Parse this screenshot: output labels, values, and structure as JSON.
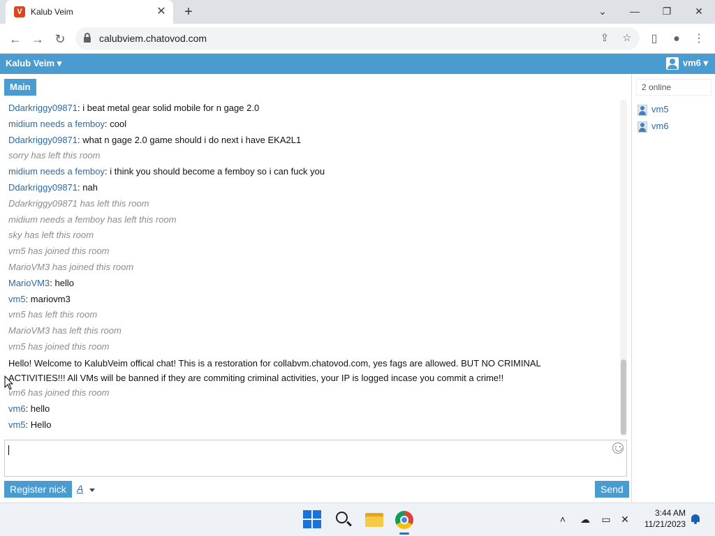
{
  "browser": {
    "tab_title": "Kalub Veim",
    "tab_favicon_letter": "V",
    "url": "calubviem.chatovod.com",
    "new_tab_glyph": "+",
    "close_glyph": "✕"
  },
  "chat": {
    "room_menu_label": "Kalub Veim ▾",
    "user_menu_label": "vm6 ▾",
    "main_tab": "Main",
    "messages": [
      {
        "nick": "Ddarkriggy09871",
        "text": "i beat metal gear solid mobile for n gage 2.0"
      },
      {
        "nick": "midium needs a femboy",
        "text": "cool"
      },
      {
        "nick": "Ddarkriggy09871",
        "text": "what n gage 2.0 game should i do next i have EKA2L1"
      },
      {
        "system": "sorry has left this room"
      },
      {
        "nick": "midium needs a femboy",
        "text": "i think you should become a femboy so i can fuck you"
      },
      {
        "nick": "Ddarkriggy09871",
        "text": "nah"
      },
      {
        "system": "Ddarkriggy09871 has left this room"
      },
      {
        "system": "midium needs a femboy has left this room"
      },
      {
        "system": "sky has left this room"
      },
      {
        "system": "vm5 has joined this room"
      },
      {
        "system": "MarioVM3 has joined this room"
      },
      {
        "nick": "MarioVM3",
        "text": "hello"
      },
      {
        "nick": "vm5",
        "text": "mariovm3"
      },
      {
        "system": "vm5 has left this room"
      },
      {
        "system": "MarioVM3 has left this room"
      },
      {
        "system": "vm5 has joined this room"
      },
      {
        "announcement": "Hello! Welcome to KalubVeim offical chat! This is a restoration for collabvm.chatovod.com, yes fags are allowed. BUT NO CRIMINAL ACTIVITIES!!! All VMs will be banned if they are commiting criminal activities, your IP is logged incase you commit a crime!!"
      },
      {
        "system": "vm6 has joined this room"
      },
      {
        "nick": "vm6",
        "text": "hello"
      },
      {
        "nick": "vm5",
        "text": "Hello"
      }
    ],
    "register_button": "Register nick",
    "font_button": "A",
    "send_button": "Send"
  },
  "sidebar": {
    "online_count": "2 online",
    "users": [
      "vm5",
      "vm6"
    ]
  },
  "taskbar": {
    "time": "3:44 AM",
    "date": "11/21/2023"
  },
  "colors": {
    "accent": "#4a9bd0",
    "nick": "#2e6aa3",
    "system_text": "#8c8c8c"
  }
}
